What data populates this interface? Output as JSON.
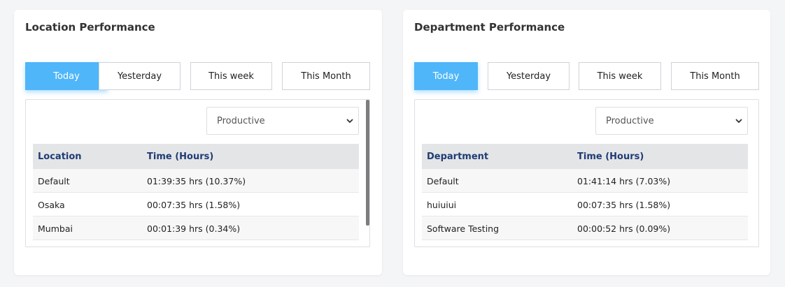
{
  "location_card": {
    "title": "Location Performance",
    "tabs": [
      {
        "label": "Today",
        "active": true
      },
      {
        "label": "Yesterday",
        "active": false
      },
      {
        "label": "This week",
        "active": false
      },
      {
        "label": "This Month",
        "active": false
      }
    ],
    "filter": {
      "selected": "Productive"
    },
    "table": {
      "headers": [
        "Location",
        "Time (Hours)"
      ],
      "rows": [
        [
          "Default",
          "01:39:35 hrs (10.37%)"
        ],
        [
          "Osaka",
          "00:07:35 hrs (1.58%)"
        ],
        [
          "Mumbai",
          "00:01:39 hrs (0.34%)"
        ]
      ]
    }
  },
  "department_card": {
    "title": "Department Performance",
    "tabs": [
      {
        "label": "Today",
        "active": true
      },
      {
        "label": "Yesterday",
        "active": false
      },
      {
        "label": "This week",
        "active": false
      },
      {
        "label": "This Month",
        "active": false
      }
    ],
    "filter": {
      "selected": "Productive"
    },
    "table": {
      "headers": [
        "Department",
        "Time (Hours)"
      ],
      "rows": [
        [
          "Default",
          "01:41:14 hrs (7.03%)"
        ],
        [
          "huiuiui",
          "00:07:35 hrs (1.58%)"
        ],
        [
          "Software Testing",
          "00:00:52 hrs (0.09%)"
        ]
      ]
    }
  },
  "colors": {
    "active_tab": "#4fb6f9",
    "header_text": "#1f3c74",
    "header_bg": "#e4e5e7"
  },
  "icons": {
    "select_chevron": "chevron-down-icon"
  }
}
